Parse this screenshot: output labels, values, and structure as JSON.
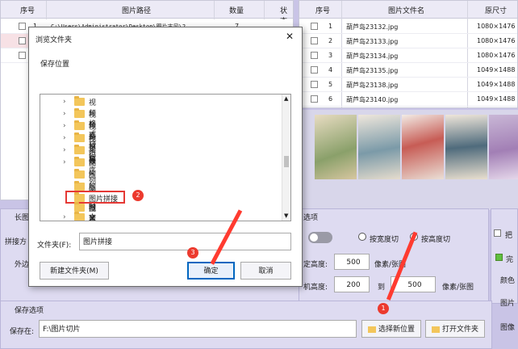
{
  "left_table": {
    "headers": [
      "序号",
      "图片路径",
      "数量",
      "状态"
    ],
    "rows": [
      {
        "num": "1",
        "path": "C:\\Users\\Administrator\\Desktop\\图片古风\\2",
        "count": "7"
      },
      {
        "num": "",
        "path": "",
        "count": ""
      },
      {
        "num": "",
        "path": "",
        "count": ""
      }
    ]
  },
  "right_table": {
    "headers": [
      "序号",
      "图片文件名",
      "原尺寸"
    ],
    "rows": [
      {
        "num": "1",
        "name": "葫芦岛23132.jpg",
        "size": "1080×1476"
      },
      {
        "num": "2",
        "name": "葫芦岛23133.jpg",
        "size": "1080×1476"
      },
      {
        "num": "3",
        "name": "葫芦岛23134.jpg",
        "size": "1080×1476"
      },
      {
        "num": "4",
        "name": "葫芦岛23135.jpg",
        "size": "1049×1488"
      },
      {
        "num": "5",
        "name": "葫芦岛23138.jpg",
        "size": "1049×1488"
      },
      {
        "num": "6",
        "name": "葫芦岛23140.jpg",
        "size": "1049×1488"
      }
    ]
  },
  "mid": {
    "section_title": "长图",
    "splice_label": "拼接方",
    "margin_label": "外边",
    "option_title": "选项",
    "toggle_opt1": "按宽度切",
    "toggle_opt2": "按高度切",
    "fixed_height_label": "定高度:",
    "fixed_height_value": "500",
    "unit1": "像素/张图",
    "random_height_label": "机高度:",
    "random_from": "200",
    "to_label": "到",
    "random_to": "500",
    "unit2": "像素/张图",
    "right_label_1": "把",
    "right_label_2": "完",
    "right_label_3": "颜色",
    "right_label_4": "图片",
    "right_label_5": "图像"
  },
  "save": {
    "section_title": "保存选项",
    "save_label": "保存在:",
    "save_path": "F:\\图片切片",
    "choose_button": "选择新位置",
    "open_button": "打开文件夹"
  },
  "dialog": {
    "title": "浏览文件夹",
    "subtitle": "保存位置",
    "tree_items": [
      "视频格式转码",
      "视频素材",
      "视频下载",
      "视频转序列图片",
      "头像",
      "图片",
      "图片临时文件",
      "图片批量处理",
      "图片拼接",
      "图片切片",
      "文本批量操作"
    ],
    "folder_label": "文件夹(F):",
    "folder_value": "图片拼接",
    "new_folder_button": "新建文件夹(M)",
    "ok_button": "确定",
    "cancel_button": "取消"
  },
  "badges": [
    "1",
    "2",
    "3"
  ],
  "colors": {
    "arrow": "#ff3b30",
    "highlight": "#e53935",
    "dialog_focus": "#0067c0",
    "folder": "#f3c65b"
  }
}
